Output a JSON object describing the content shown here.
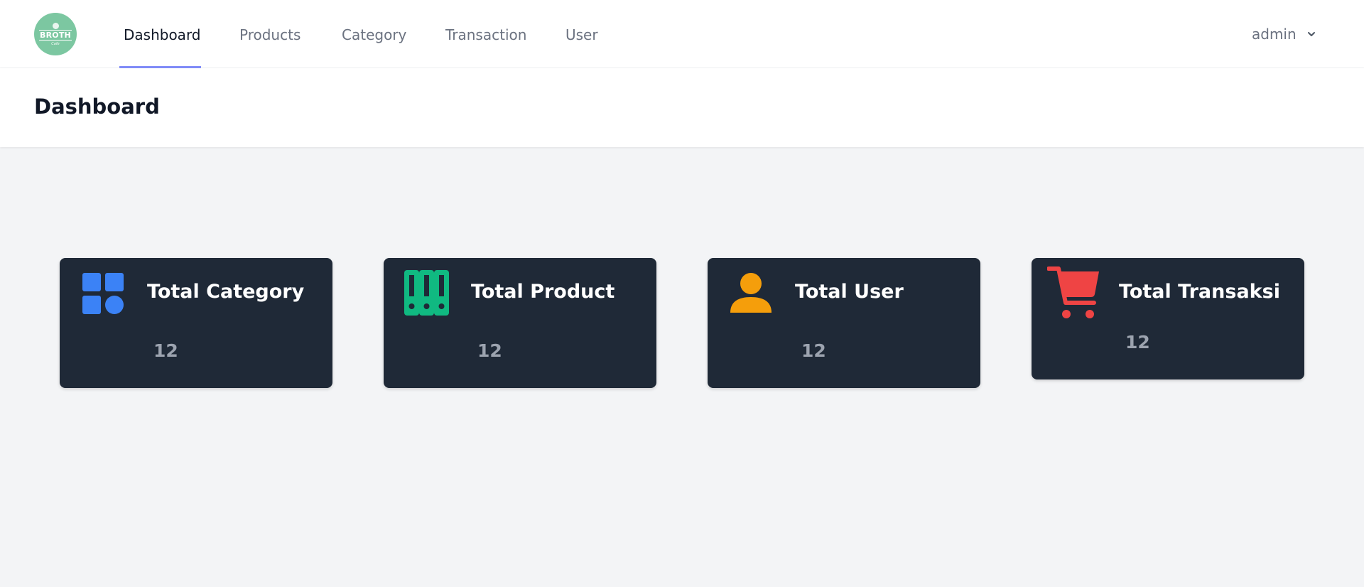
{
  "brand": {
    "logo_text": "BROTH",
    "logo_subtext": "Cafe"
  },
  "nav": {
    "items": [
      {
        "label": "Dashboard",
        "active": true
      },
      {
        "label": "Products",
        "active": false
      },
      {
        "label": "Category",
        "active": false
      },
      {
        "label": "Transaction",
        "active": false
      },
      {
        "label": "User",
        "active": false
      }
    ],
    "user_label": "admin",
    "accent_color": "#818cf8"
  },
  "header": {
    "title": "Dashboard"
  },
  "cards": [
    {
      "title": "Total Category",
      "value": "12",
      "icon": "category-grid-icon",
      "icon_color": "#3b82f6"
    },
    {
      "title": "Total Product",
      "value": "12",
      "icon": "binders-icon",
      "icon_color": "#10b981"
    },
    {
      "title": "Total User",
      "value": "12",
      "icon": "user-icon",
      "icon_color": "#f59e0b"
    },
    {
      "title": "Total Transaksi",
      "value": "12",
      "icon": "shopping-cart-icon",
      "icon_color": "#ef4444"
    }
  ]
}
